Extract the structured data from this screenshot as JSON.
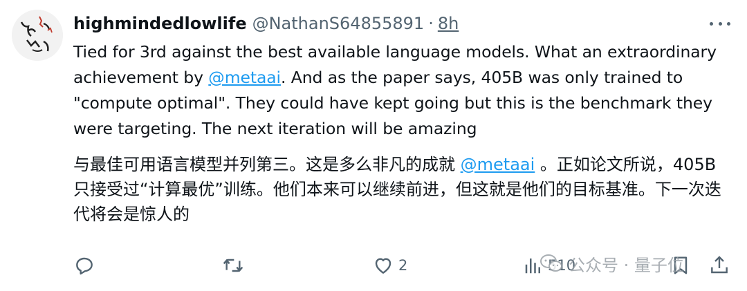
{
  "tweet": {
    "display_name": "highmindedlowlife",
    "handle": "@NathanS64855891",
    "separator": "·",
    "time": "8h",
    "more_icon": "more-horizontal-icon",
    "text_en_part1": "Tied for 3rd against the best available language models. What an extraordinary achievement by ",
    "mention_en": "@metaai",
    "text_en_part2": ". And as the paper says, 405B was only trained to \"compute optimal\". They could have kept going but this is the benchmark they were targeting. The next iteration will be amazing",
    "text_zh_part1": "与最佳可用语言模型并列第三。这是多么非凡的成就 ",
    "mention_zh": "@metaai",
    "text_zh_part2": " 。正如论文所说，405B 只接受过“计算最优”训练。他们本来可以继续前进，但这就是他们的目标基准。下一次迭代将会是惊人的"
  },
  "actions": {
    "reply_icon": "reply-icon",
    "retweet_icon": "retweet-icon",
    "like_icon": "heart-icon",
    "like_count": "2",
    "views_icon": "views-icon",
    "views_count": "510",
    "bookmark_icon": "bookmark-icon",
    "share_icon": "share-icon"
  },
  "watermark": {
    "text": "公众号 · 量子位",
    "icon": "wechat-icon"
  },
  "colors": {
    "text": "#0f1419",
    "secondary": "#536471",
    "link": "#1d9bf0"
  }
}
